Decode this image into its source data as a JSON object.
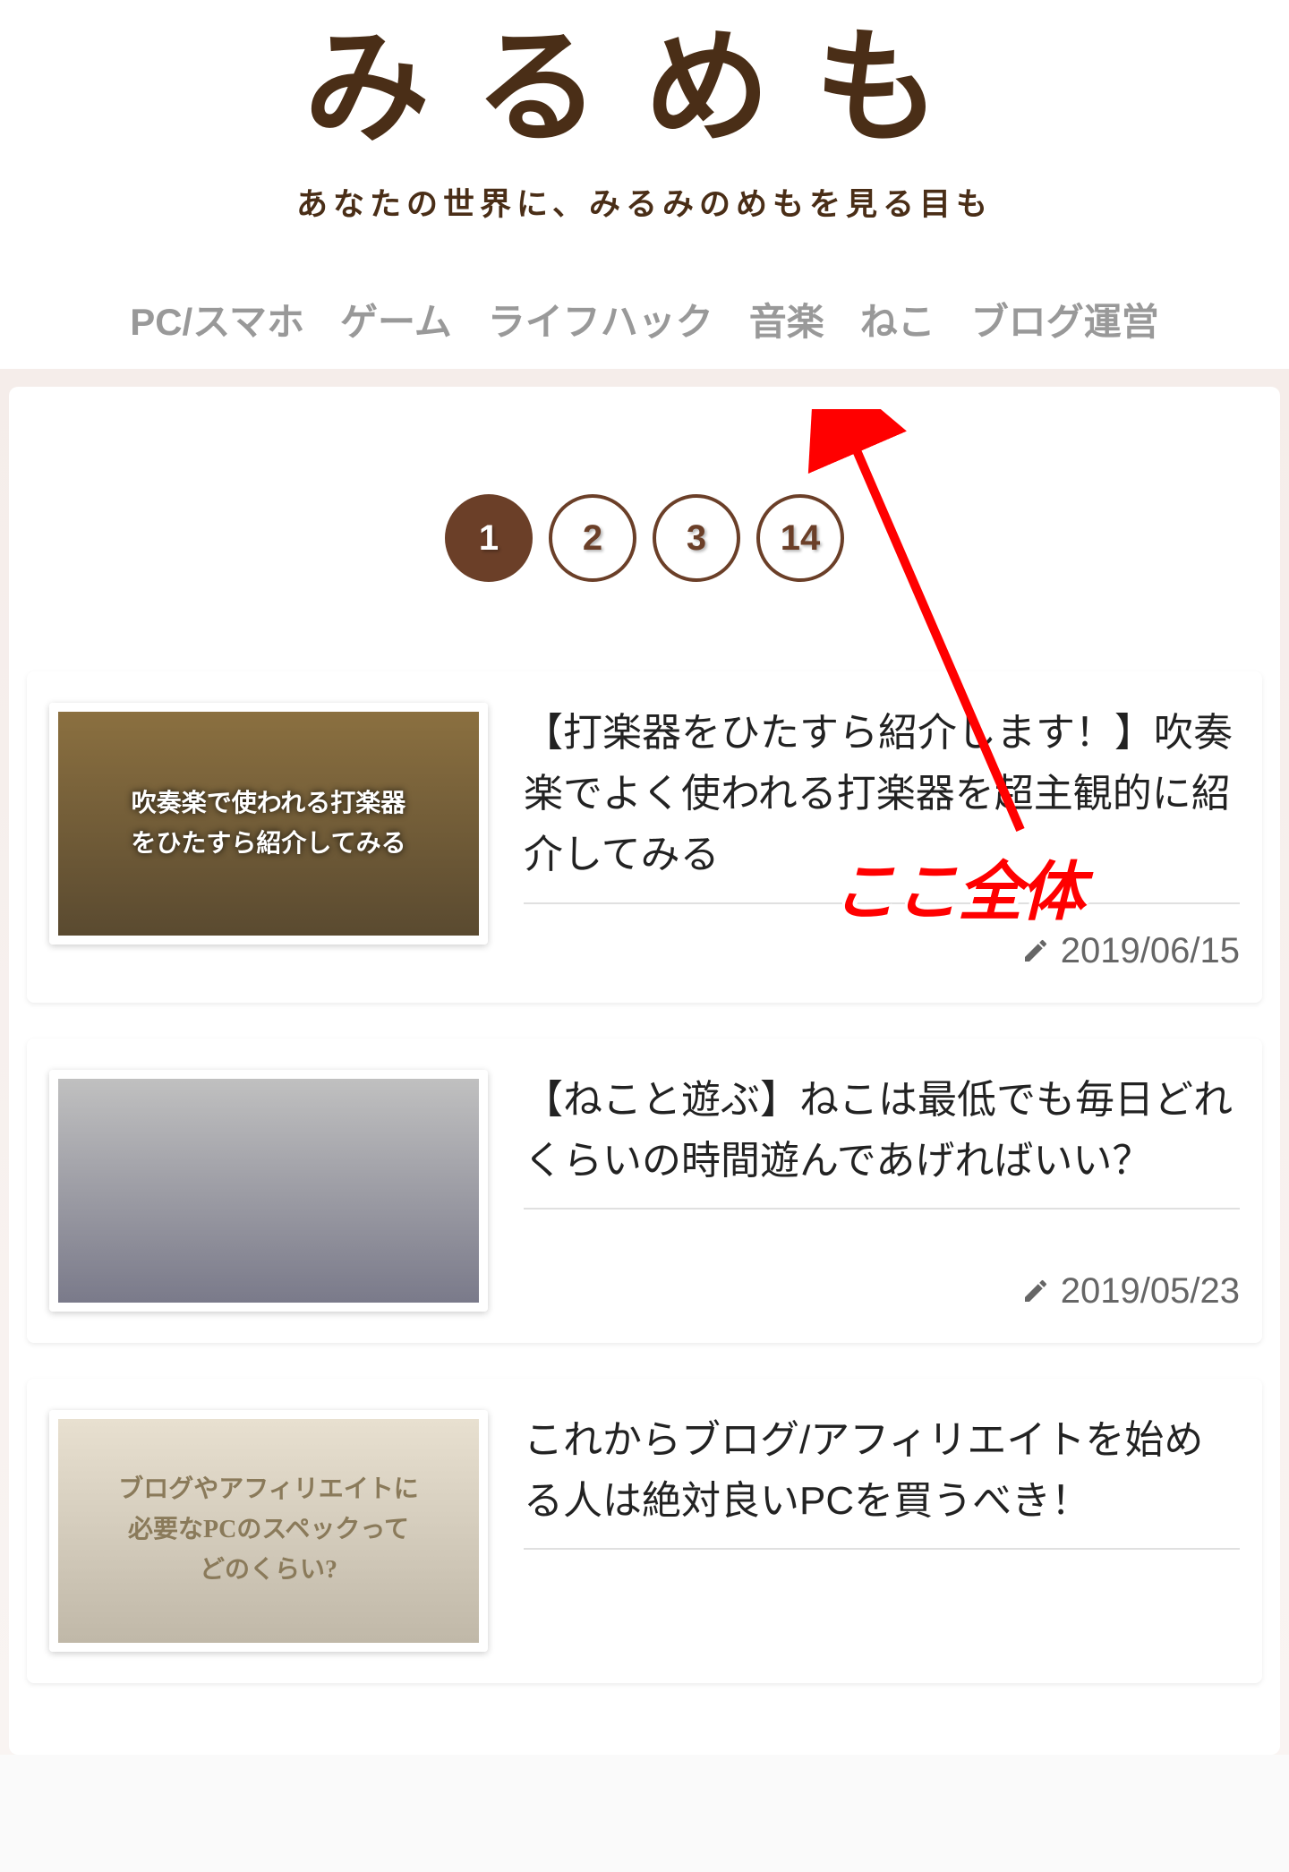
{
  "site": {
    "title": "みるめも",
    "tagline": "あなたの世界に、みるみのめもを見る目も"
  },
  "nav": {
    "items": [
      "PC/スマホ",
      "ゲーム",
      "ライフハック",
      "音楽",
      "ねこ",
      "ブログ運営"
    ]
  },
  "pagination": {
    "pages": [
      "1",
      "2",
      "3",
      "14"
    ],
    "active_index": 0
  },
  "annotation": {
    "text": "ここ全体"
  },
  "articles": [
    {
      "title": "【打楽器をひたすら紹介します！】吹奏楽でよく使われる打楽器を超主観的に紹介してみる",
      "date": "2019/06/15",
      "thumb_text": "吹奏楽で使われる打楽器\nをひたすら紹介してみる"
    },
    {
      "title": "【ねこと遊ぶ】ねこは最低でも毎日どれくらいの時間遊んであげればいい？",
      "date": "2019/05/23",
      "thumb_text": ""
    },
    {
      "title": "これからブログ/アフィリエイトを始める人は絶対良いPCを買うべき！",
      "date": "",
      "thumb_text": "ブログやアフィリエイトに\n必要なPCのスペックって\nどのくらい?"
    }
  ]
}
